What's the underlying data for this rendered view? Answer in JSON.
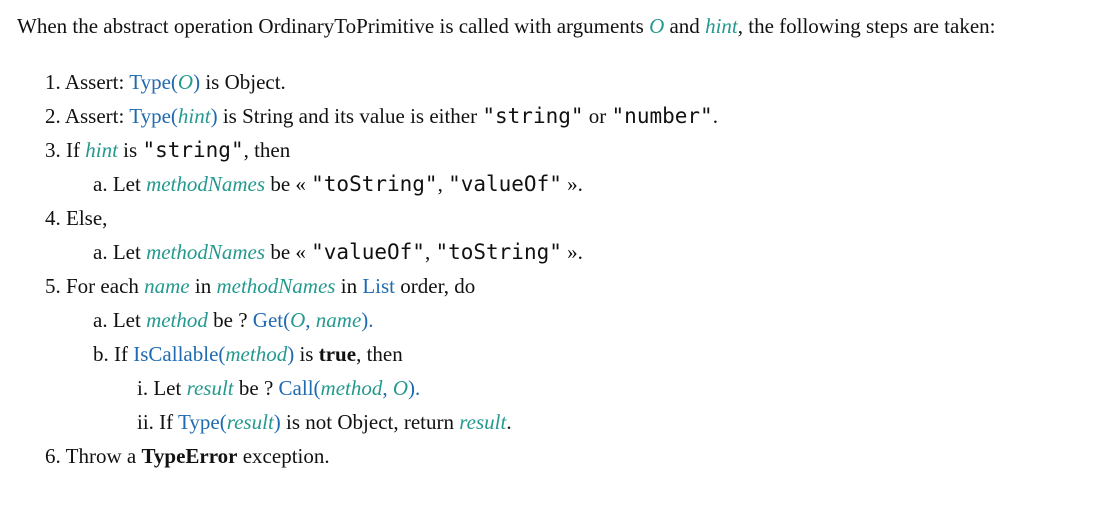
{
  "intro": {
    "p1": "When the abstract operation OrdinaryToPrimitive is called with arguments ",
    "O": "O",
    "and": " and ",
    "hint": "hint",
    "p2": ", the following steps are taken:"
  },
  "steps": {
    "s1": {
      "num": "1. ",
      "assert": "Assert: ",
      "type": "Type",
      "lp": "(",
      "O": "O",
      "rp": ")",
      "rest": " is Object."
    },
    "s2": {
      "num": "2. ",
      "assert": "Assert: ",
      "type": "Type",
      "lp": "(",
      "hint": "hint",
      "rp": ")",
      "mid": " is String and its value is either ",
      "string": "\"string\"",
      "or": " or ",
      "number": "\"number\"",
      "end": "."
    },
    "s3": {
      "num": "3. ",
      "if": "If ",
      "hint": "hint",
      "is": " is ",
      "string": "\"string\"",
      "then": ", then"
    },
    "s3a": {
      "num": "a. ",
      "let": "Let ",
      "var": "methodNames",
      "be": " be « ",
      "v1": "\"toString\"",
      "comma": ", ",
      "v2": "\"valueOf\"",
      "end": " »."
    },
    "s4": {
      "num": "4. ",
      "text": "Else,"
    },
    "s4a": {
      "num": "a. ",
      "let": "Let ",
      "var": "methodNames",
      "be": " be « ",
      "v1": "\"valueOf\"",
      "comma": ", ",
      "v2": "\"toString\"",
      "end": " »."
    },
    "s5": {
      "num": "5. ",
      "for": "For each ",
      "name": "name",
      "in": " in ",
      "var": "methodNames",
      "in2": " in ",
      "list": "List",
      "order": " order, do"
    },
    "s5a": {
      "num": "a. ",
      "let": "Let ",
      "method": "method",
      "be": " be ? ",
      "get": "Get",
      "lp": "(",
      "O": "O",
      "comma": ", ",
      "name": "name",
      "rp": ")."
    },
    "s5b": {
      "num": "b. ",
      "if": "If ",
      "iscallable": "IsCallable",
      "lp": "(",
      "method": "method",
      "rp": ")",
      "is": " is ",
      "true": "true",
      "then": ", then"
    },
    "s5bi": {
      "num": "i. ",
      "let": "Let ",
      "result": "result",
      "be": " be ? ",
      "call": "Call",
      "lp": "(",
      "method": "method",
      "comma": ", ",
      "O": "O",
      "rp": ")."
    },
    "s5bii": {
      "num": "ii. ",
      "if": "If ",
      "type": "Type",
      "lp": "(",
      "result": "result",
      "rp": ")",
      "mid": " is not Object, return ",
      "result2": "result",
      "end": "."
    },
    "s6": {
      "num": "6. ",
      "throw": "Throw a ",
      "err": "TypeError",
      "rest": " exception."
    }
  }
}
